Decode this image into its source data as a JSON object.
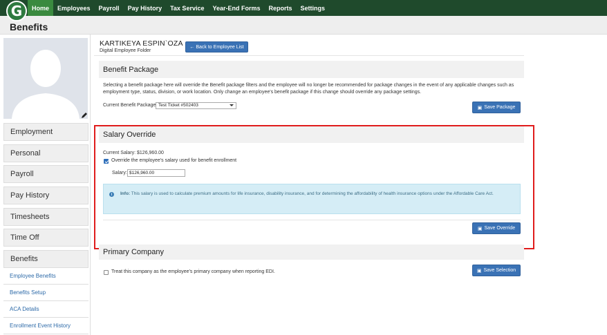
{
  "app": {
    "logo_letter": "G"
  },
  "nav": [
    "Home",
    "Employees",
    "Payroll",
    "Pay History",
    "Tax Service",
    "Year-End Forms",
    "Reports",
    "Settings"
  ],
  "page_title": "Benefits",
  "sidebar": {
    "sections": [
      "Employment",
      "Personal",
      "Payroll",
      "Pay History",
      "Timesheets",
      "Time Off",
      "Benefits"
    ],
    "links": [
      "Employee Benefits",
      "Benefits Setup",
      "ACA Details",
      "Enrollment Event History"
    ]
  },
  "employee": {
    "name": "KARTIKEYA ESPIN`OZA",
    "subtitle": "Digital Employee Folder",
    "back_button": "Back to Employee List"
  },
  "benefit_package": {
    "title": "Benefit Package",
    "description": "Selecting a benefit package here will override the Benefit package filters and the employee will no longer be recommended for package changes in the event of any applicable changes such as employment type, status, division, or work location. Only change an employee's benefit package if this change should override any package settings.",
    "current_label": "Current Benefit Package:",
    "current_value": "Test Ticket #502403",
    "save_button": "Save Package"
  },
  "salary_override": {
    "title": "Salary Override",
    "current_salary": "Current Salary: $126,960.00",
    "checkbox_label": "Override the employee's salary used for benefit enrollment",
    "checked": true,
    "salary_label": "Salary:",
    "salary_value": "$126,960.00",
    "info_label": "Info:",
    "info_text": "This salary is used to calculate premium amounts for life insurance, disability insurance, and for determining the affordability of health insurance options under the Affordable Care Act.",
    "save_button": "Save Override"
  },
  "primary_company": {
    "title": "Primary Company",
    "checkbox_label": "Treat this company as the employee's primary company when reporting EDI.",
    "checked": false,
    "save_button": "Save Selection"
  },
  "colors": {
    "nav_bg": "#1f4a2c",
    "nav_active": "#3a8a3f",
    "button": "#3a72b5",
    "highlight": "#e01b1b",
    "info_bg": "#d5edf6"
  }
}
